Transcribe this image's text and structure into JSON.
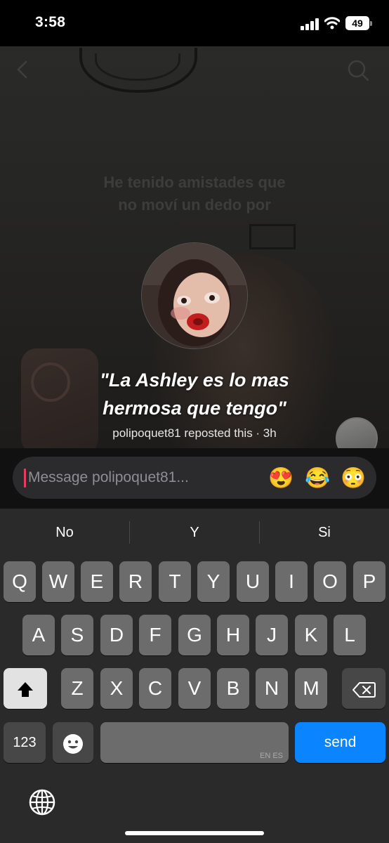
{
  "status_bar": {
    "time": "3:58",
    "battery": "49"
  },
  "story": {
    "background_caption_line1": "He tenido amistades que",
    "background_caption_line2": "no moví un dedo por",
    "quote_line1": "\"La Ashley es lo mas",
    "quote_line2": "hermosa que tengo\"",
    "repost_text": "polipoquet81 reposted this · 3h"
  },
  "message": {
    "placeholder": "Message polipoquet81...",
    "quick_emojis": [
      "😍",
      "😂",
      "😳"
    ]
  },
  "keyboard": {
    "suggestions": [
      "No",
      "Y",
      "Si"
    ],
    "row1": [
      "Q",
      "W",
      "E",
      "R",
      "T",
      "Y",
      "U",
      "I",
      "O",
      "P"
    ],
    "row2": [
      "A",
      "S",
      "D",
      "F",
      "G",
      "H",
      "J",
      "K",
      "L"
    ],
    "row3": [
      "Z",
      "X",
      "C",
      "V",
      "B",
      "N",
      "M"
    ],
    "numbers_key": "123",
    "space_language": "EN ES",
    "send_key": "send"
  },
  "colors": {
    "accent_send": "#0a84ff",
    "cursor": "#e63c5f",
    "add_badge": "#c62a46"
  }
}
